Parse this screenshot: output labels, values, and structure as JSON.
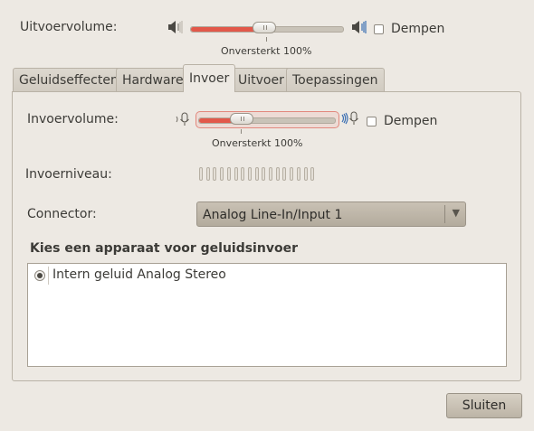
{
  "output": {
    "volume_label": "Uitvoervolume:",
    "amplified_label": "Onversterkt 100%",
    "mute_label": "Dempen",
    "muted": false,
    "volume_percent": 100,
    "knob_position_fraction": 0.49
  },
  "tabs": [
    {
      "label": "Geluidseffecten",
      "active": false
    },
    {
      "label": "Hardware",
      "active": false
    },
    {
      "label": "Invoer",
      "active": true
    },
    {
      "label": "Uitvoer",
      "active": false
    },
    {
      "label": "Toepassingen",
      "active": false
    }
  ],
  "input": {
    "volume_label": "Invoervolume:",
    "amplified_label": "Onversterkt 100%",
    "mute_label": "Dempen",
    "muted": false,
    "volume_percent": 100,
    "knob_position_fraction": 0.32,
    "level_label": "Invoerniveau:",
    "level_fraction": 0,
    "connector_label": "Connector:",
    "connector_value": "Analog Line-In/Input 1",
    "device_heading": "Kies een apparaat voor geluidsinvoer",
    "devices": [
      {
        "name": "Intern geluid Analog Stereo",
        "selected": true
      }
    ]
  },
  "footer": {
    "close_label": "Sluiten"
  },
  "colors": {
    "window_bg": "#ede9e3",
    "slider_fill": "#e2584a",
    "focus_ring": "#e2887d"
  },
  "icons": {
    "output_low": "speaker-low-icon",
    "output_high": "speaker-high-icon",
    "input_low": "microphone-low-icon",
    "input_high": "microphone-high-icon",
    "combo_arrow": "chevron-down-icon"
  }
}
